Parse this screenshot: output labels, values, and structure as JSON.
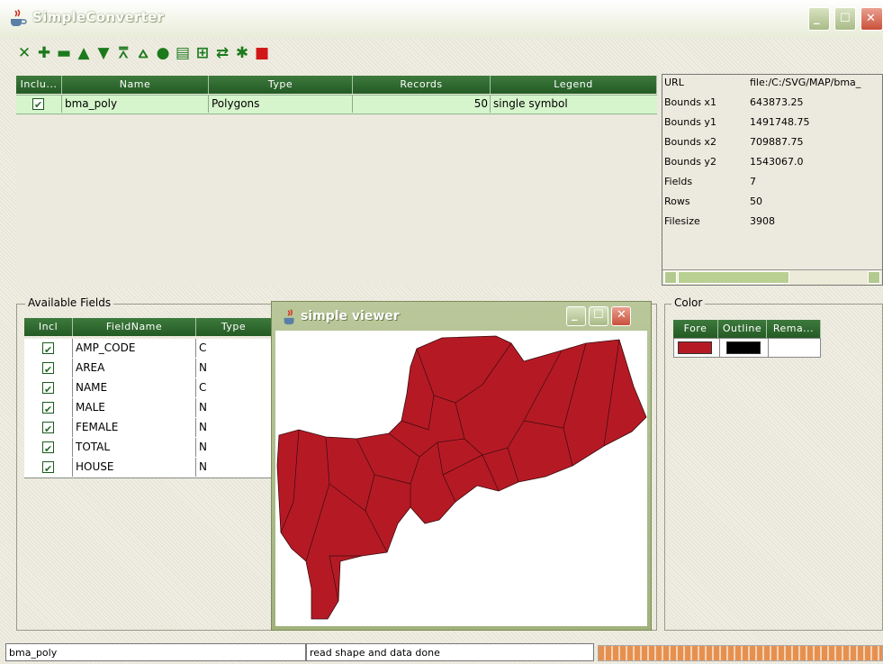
{
  "window": {
    "title": "SimpleConverter"
  },
  "toolbar": {
    "buttons": [
      {
        "icon": "close-layer-icon",
        "glyph": "✕"
      },
      {
        "icon": "add-icon",
        "glyph": "✚"
      },
      {
        "icon": "remove-icon",
        "glyph": "▬"
      },
      {
        "icon": "move-up-icon",
        "glyph": "▲"
      },
      {
        "icon": "move-down-icon",
        "glyph": "▼"
      },
      {
        "icon": "move-top-icon",
        "glyph": "⩞"
      },
      {
        "icon": "move-bottom-icon",
        "glyph": "⩟"
      },
      {
        "icon": "globe-icon",
        "glyph": "●"
      },
      {
        "icon": "table-icon",
        "glyph": "▤"
      },
      {
        "icon": "export-icon",
        "glyph": "⊞"
      },
      {
        "icon": "convert-icon",
        "glyph": "⇄"
      },
      {
        "icon": "settings-icon",
        "glyph": "✱"
      },
      {
        "icon": "stop-icon",
        "glyph": "■"
      }
    ]
  },
  "layers_table": {
    "headers": [
      "Inclu...",
      "Name",
      "Type",
      "Records",
      "Legend"
    ],
    "rows": [
      {
        "include": true,
        "name": "bma_poly",
        "type": "Polygons",
        "records": "50",
        "legend": "single symbol"
      }
    ]
  },
  "info": {
    "rows": [
      {
        "key": "URL",
        "value": "file:/C:/SVG/MAP/bma_"
      },
      {
        "key": "Bounds x1",
        "value": "643873.25"
      },
      {
        "key": "Bounds y1",
        "value": "1491748.75"
      },
      {
        "key": "Bounds x2",
        "value": "709887.75"
      },
      {
        "key": "Bounds y2",
        "value": "1543067.0"
      },
      {
        "key": "Fields",
        "value": "7"
      },
      {
        "key": "Rows",
        "value": "50"
      },
      {
        "key": "Filesize",
        "value": "3908"
      }
    ]
  },
  "fields": {
    "group_label": "Available Fields",
    "headers": [
      "Incl",
      "FieldName",
      "Type"
    ],
    "rows": [
      {
        "include": true,
        "name": "AMP_CODE",
        "type": "C"
      },
      {
        "include": true,
        "name": "AREA",
        "type": "N"
      },
      {
        "include": true,
        "name": "NAME",
        "type": "C"
      },
      {
        "include": true,
        "name": "MALE",
        "type": "N"
      },
      {
        "include": true,
        "name": "FEMALE",
        "type": "N"
      },
      {
        "include": true,
        "name": "TOTAL",
        "type": "N"
      },
      {
        "include": true,
        "name": "HOUSE",
        "type": "N"
      }
    ]
  },
  "color": {
    "group_label": "Color",
    "headers": [
      "Fore",
      "Outline",
      "Rema..."
    ],
    "fore": "#b51a24",
    "outline": "#000000"
  },
  "viewer": {
    "title": "simple viewer",
    "fill": "#b51a24"
  },
  "status": {
    "layer": "bma_poly",
    "message": "read shape and data done"
  }
}
